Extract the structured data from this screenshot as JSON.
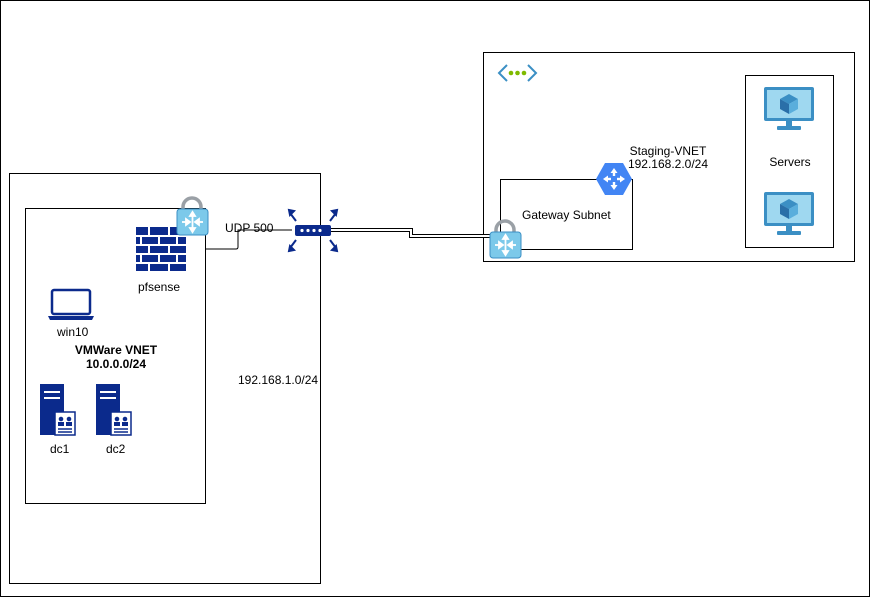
{
  "labels": {
    "pfsense": "pfsense",
    "win10": "win10",
    "vmware_vnet_name": "VMWare VNET",
    "vmware_vnet_cidr": "10.0.0.0/24",
    "dc1": "dc1",
    "dc2": "dc2",
    "udp_port": "UDP 500",
    "lan_cidr": "192.168.1.0/24",
    "staging_vnet_name": "Staging-VNET",
    "staging_vnet_cidr": "192.168.2.0/24",
    "gateway_subnet": "Gateway Subnet",
    "servers": "Servers"
  },
  "icons": {
    "firewall": "firewall-brick-icon",
    "vpn_gateway": "vpn-gateway-lock-icon",
    "router": "router-icon",
    "laptop": "laptop-icon",
    "server": "server-tower-icon",
    "vm": "virtual-machine-icon",
    "vnet": "virtual-network-icon",
    "cloud_router": "cloud-router-hexagon-icon"
  },
  "colors": {
    "navy": "#0b2a8c",
    "azure_light": "#7cc9ea",
    "azure_dark": "#3b8fc4",
    "gcp_blue": "#4285f4",
    "green_dot": "#7fba00",
    "border": "#000000"
  }
}
